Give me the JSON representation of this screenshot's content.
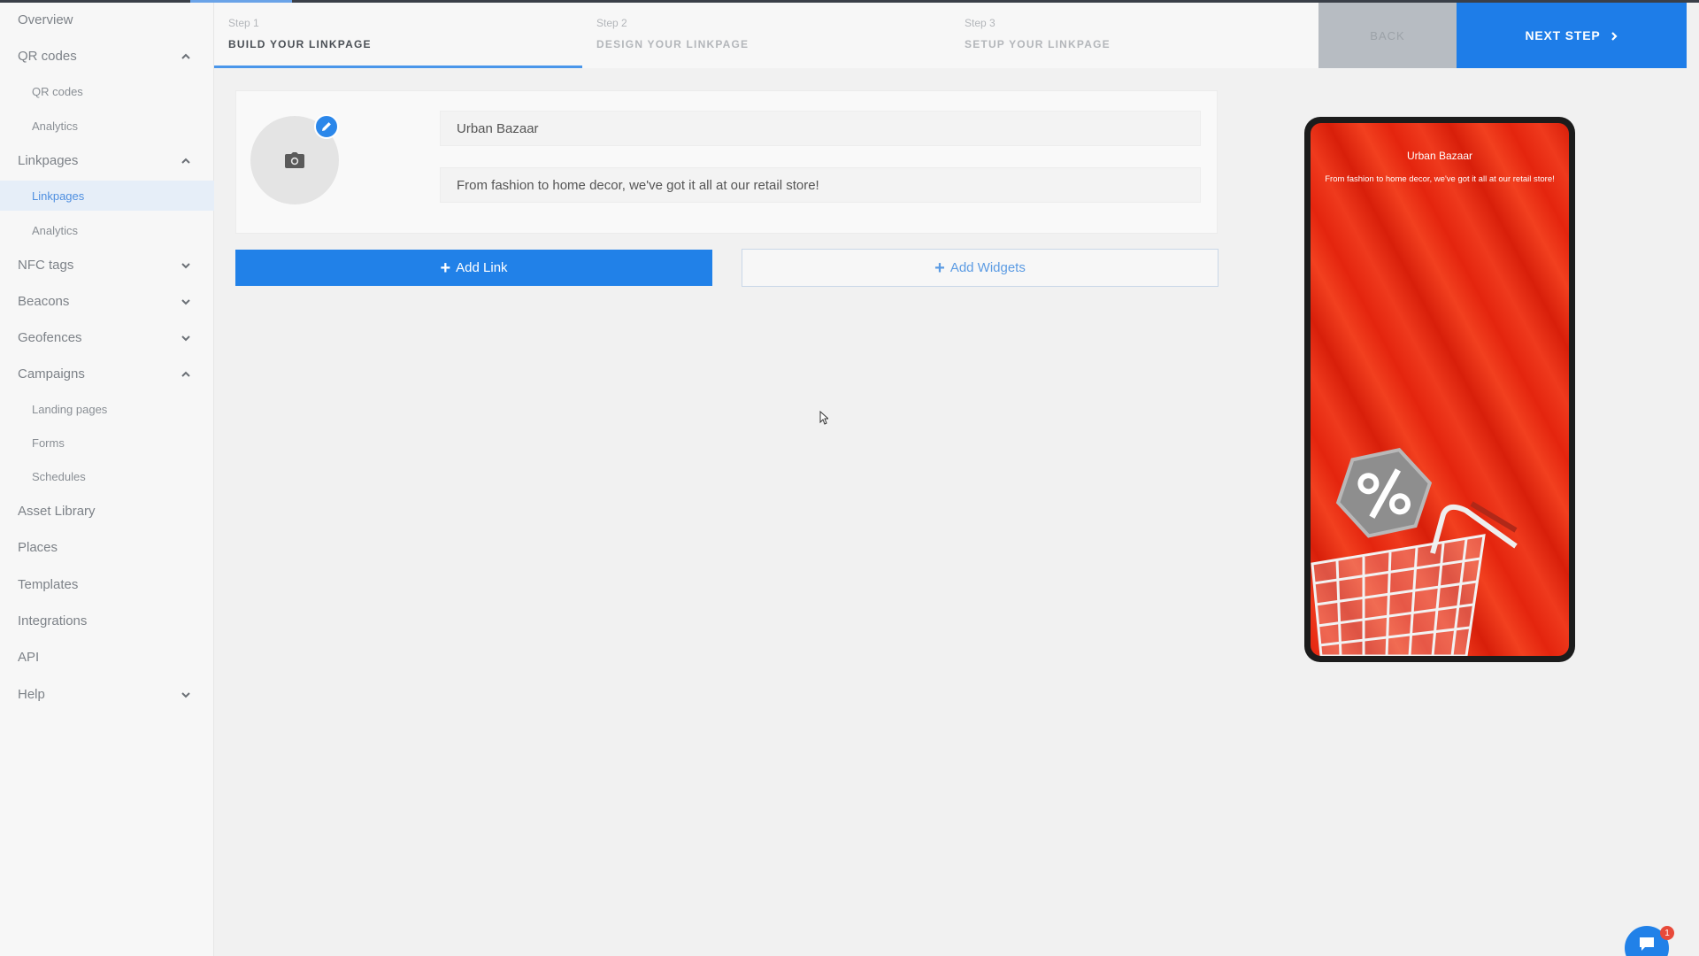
{
  "sidebar": {
    "items": [
      {
        "label": "Overview"
      },
      {
        "label": "QR codes"
      },
      {
        "label": "QR codes"
      },
      {
        "label": "Analytics"
      },
      {
        "label": "Linkpages"
      },
      {
        "label": "Linkpages"
      },
      {
        "label": "Analytics"
      },
      {
        "label": "NFC tags"
      },
      {
        "label": "Beacons"
      },
      {
        "label": "Geofences"
      },
      {
        "label": "Campaigns"
      },
      {
        "label": "Landing pages"
      },
      {
        "label": "Forms"
      },
      {
        "label": "Schedules"
      },
      {
        "label": "Asset Library"
      },
      {
        "label": "Places"
      },
      {
        "label": "Templates"
      },
      {
        "label": "Integrations"
      },
      {
        "label": "API"
      },
      {
        "label": "Help"
      }
    ]
  },
  "stepper": {
    "steps": [
      {
        "num": "Step 1",
        "title": "BUILD YOUR LINKPAGE"
      },
      {
        "num": "Step 2",
        "title": "DESIGN YOUR LINKPAGE"
      },
      {
        "num": "Step 3",
        "title": "SETUP YOUR LINKPAGE"
      }
    ],
    "back_label": "BACK",
    "next_label": "NEXT STEP"
  },
  "profile": {
    "name": "Urban Bazaar",
    "description": "From fashion to home decor, we've got it all at our retail store!"
  },
  "actions": {
    "add_link": "Add Link",
    "add_widgets": "Add Widgets"
  },
  "preview": {
    "title": "Urban Bazaar",
    "description": "From fashion to home decor, we've got it all at our retail store!"
  },
  "chat": {
    "badge_count": "1"
  },
  "colors": {
    "primary": "#2181e8",
    "accent": "#4a96ea",
    "promo_red": "#e4250e"
  }
}
